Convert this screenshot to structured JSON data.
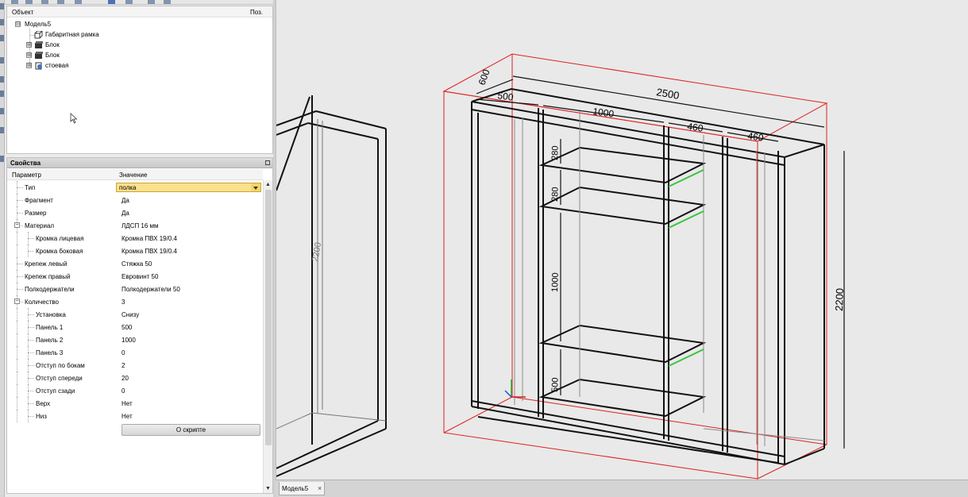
{
  "tree": {
    "col_object": "Объект",
    "col_pos": "Поз.",
    "items": [
      {
        "label": "Модель5",
        "toggle": "⊟"
      },
      {
        "label": "Габаритная рамка",
        "toggle": ""
      },
      {
        "label": "Блок",
        "toggle": "⊞"
      },
      {
        "label": "Блок",
        "toggle": "⊞"
      },
      {
        "label": "стоевая",
        "toggle": "⊞"
      }
    ]
  },
  "properties": {
    "title": "Свойства",
    "col_param": "Параметр",
    "col_value": "Значение",
    "rows": [
      {
        "name": "Тип",
        "value": "полка"
      },
      {
        "name": "Фрагмент",
        "value": "Да"
      },
      {
        "name": "Размер",
        "value": "Да"
      },
      {
        "name": "Материал",
        "value": "ЛДСП 16 мм"
      },
      {
        "name": "Кромка лицевая",
        "value": "Кромка ПВХ 19/0.4"
      },
      {
        "name": "Кромка боковая",
        "value": "Кромка ПВХ 19/0.4"
      },
      {
        "name": "Крепеж левый",
        "value": "Стяжка 50"
      },
      {
        "name": "Крепеж правый",
        "value": "Евровинт 50"
      },
      {
        "name": "Полкодержатели",
        "value": "Полкодержатели 50"
      },
      {
        "name": "Количество",
        "value": "3"
      },
      {
        "name": "Установка",
        "value": "Снизу"
      },
      {
        "name": "Панель 1",
        "value": "500"
      },
      {
        "name": "Панель 2",
        "value": "1000"
      },
      {
        "name": "Панель 3",
        "value": "0"
      },
      {
        "name": "Отступ по бокам",
        "value": "2"
      },
      {
        "name": "Отступ спереди",
        "value": "20"
      },
      {
        "name": "Отступ сзади",
        "value": "0"
      },
      {
        "name": "Верх",
        "value": "Нет"
      },
      {
        "name": "Низ",
        "value": "Нет"
      }
    ],
    "about_button": "О скрипте"
  },
  "viewport": {
    "dimensions": {
      "width_total": "2500",
      "depth": "600",
      "section1": "500",
      "section2": "1000",
      "section3": "460",
      "section4": "460",
      "height_total": "2200",
      "shelf_gap1": "280",
      "shelf_gap2": "280",
      "shelf_gap3": "1000",
      "shelf_gap4": "500",
      "side_height": "2200"
    },
    "colors": {
      "frame": "#e02020",
      "lines": "#111111",
      "highlight": "#3cc43c",
      "background": "#e9e9e9"
    }
  },
  "tabs": {
    "model_tab": "Модель5",
    "close": "×"
  }
}
